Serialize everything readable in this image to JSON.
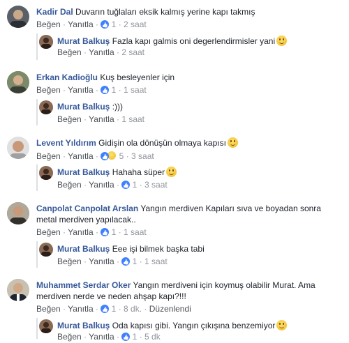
{
  "labels": {
    "like": "Beğen",
    "reply": "Yanıtla",
    "dot": "·"
  },
  "comments": [
    {
      "author": "Kadir Dal",
      "text": "Duvarın tuğlaları eksik kalmış yerine kapı takmış",
      "likes": "1",
      "time": "2 saat",
      "reply": {
        "author": "Murat Balkuş",
        "text": "Fazla kapı galmis oni degerlendirmisler yani",
        "time": "2 saat"
      }
    },
    {
      "author": "Erkan Kadioğlu",
      "text": "Kuş besleyenler için",
      "likes": "1",
      "time": "1 saat",
      "reply": {
        "author": "Murat Balkuş",
        "text": ":)))",
        "time": "1 saat"
      }
    },
    {
      "author": "Levent Yıldırım",
      "text": "Gidişin ola dönüşün olmaya kapısı",
      "likes": "5",
      "time": "3 saat",
      "reply": {
        "author": "Murat Balkuş",
        "text": "Hahaha süper",
        "likes": "1",
        "time": "3 saat"
      }
    },
    {
      "author": "Canpolat Canpolat Arslan",
      "text": "Yangın merdiven Kapıları sıva ve boyadan sonra",
      "text2": "metal merdiven yapılacak..",
      "likes": "1",
      "time": "1 saat",
      "reply": {
        "author": "Murat Balkuş",
        "text": "Eee işi bilmek başka tabi",
        "likes": "1",
        "time": "1 saat"
      }
    },
    {
      "author": "Muhammet Serdar Oker",
      "text": "Yangın merdiveni için koymuş olabilir Murat. Ama",
      "text2": "merdiven nerde ve neden ahşap kapı?!!!",
      "likes": "1",
      "time": "8 dk.",
      "edited": "Düzenlendi",
      "reply": {
        "author": "Murat Balkuş",
        "text": "Oda kapısı gibi. Yangın çıkışına benzemiyor",
        "likes": "1",
        "time": "5 dk"
      }
    }
  ],
  "colors": {
    "link": "#365899",
    "meta": "#90949c",
    "like": "#4080ff"
  }
}
